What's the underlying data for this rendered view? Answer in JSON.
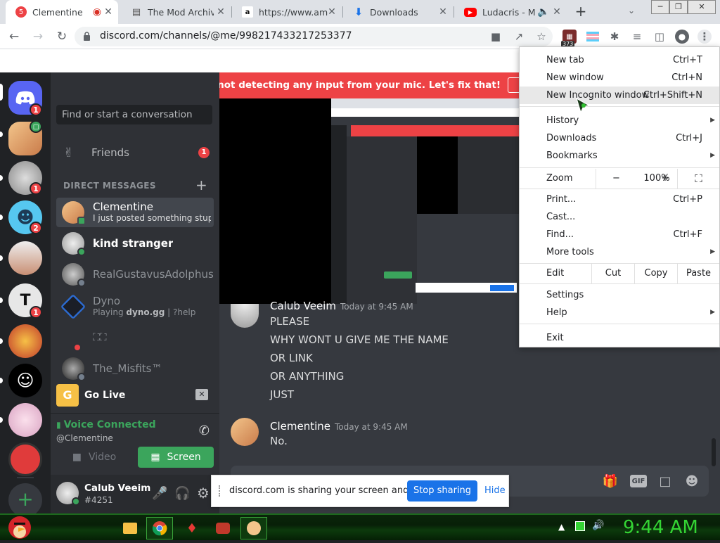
{
  "tabs": [
    {
      "title": "Clementine",
      "active": true
    },
    {
      "title": "The Mod Archive"
    },
    {
      "title": "https://www.amaz"
    },
    {
      "title": "Downloads"
    },
    {
      "title": "Ludacris - Mo"
    }
  ],
  "address": {
    "url": "discord.com/channels/@me/998217433217253377"
  },
  "extension_badge": "373",
  "banner": {
    "text": "Well, it looks like Discord is not detecting any input from your mic. Let's fix that!"
  },
  "guild_badges": {
    "home": "1",
    "g3": "1",
    "g4": "2",
    "g6": "1"
  },
  "sidebar": {
    "search_placeholder": "Find or start a conversation",
    "friends_label": "Friends",
    "friends_badge": "1",
    "dm_header": "DIRECT MESSAGES",
    "dms": [
      {
        "name": "Clementine",
        "sub": "I just posted something stupid ..."
      },
      {
        "name": "kind stranger",
        "sub": ""
      },
      {
        "name": "RealGustavusAdolphus",
        "sub": ""
      },
      {
        "name": "Dyno",
        "sub_prefix": "Playing ",
        "sub_bold": "dyno.gg",
        "sub_suffix": " | ?help"
      },
      {
        "name": "⛶⛶",
        "sub": ""
      },
      {
        "name": "The_Misfits™",
        "sub": ""
      }
    ],
    "go_live": "Go Live",
    "voice_status": "Voice Connected",
    "voice_channel": "@Clementine",
    "video_label": "Video",
    "screen_label": "Screen",
    "user_name": "Calub Veeim",
    "user_tag": "#4251"
  },
  "chat": {
    "partial_author": "Calub Veeim",
    "partial_time": "Today at 9:45 AM",
    "lines": [
      "PLEASE",
      "WHY WONT U GIVE ME THE NAME",
      "OR LINK",
      "OR ANYTHING",
      "JUST"
    ],
    "second_author": "Clementine",
    "second_time": "Today at 9:45 AM",
    "second_text": "No."
  },
  "share_bar": {
    "text": "discord.com is sharing your screen and audio.",
    "stop_label": "Stop sharing",
    "hide_label": "Hide"
  },
  "menu": {
    "new_tab": {
      "label": "New tab",
      "shortcut": "Ctrl+T"
    },
    "new_window": {
      "label": "New window",
      "shortcut": "Ctrl+N"
    },
    "new_incognito": {
      "label": "New Incognito window",
      "shortcut": "Ctrl+Shift+N"
    },
    "history": {
      "label": "History"
    },
    "downloads": {
      "label": "Downloads",
      "shortcut": "Ctrl+J"
    },
    "bookmarks": {
      "label": "Bookmarks"
    },
    "zoom": {
      "label": "Zoom",
      "minus": "−",
      "value": "100%",
      "plus": "+"
    },
    "print": {
      "label": "Print...",
      "shortcut": "Ctrl+P"
    },
    "cast": {
      "label": "Cast..."
    },
    "find": {
      "label": "Find...",
      "shortcut": "Ctrl+F"
    },
    "more_tools": {
      "label": "More tools"
    },
    "edit": {
      "label": "Edit",
      "cut": "Cut",
      "copy": "Copy",
      "paste": "Paste"
    },
    "settings": {
      "label": "Settings"
    },
    "help": {
      "label": "Help"
    },
    "exit": {
      "label": "Exit"
    }
  },
  "taskbar": {
    "clock": "9:44 AM"
  },
  "colors": {
    "discord_blurple": "#5865f2",
    "discord_red": "#ed4245",
    "online_green": "#3ba55c",
    "chrome_blue": "#1a73e8"
  }
}
